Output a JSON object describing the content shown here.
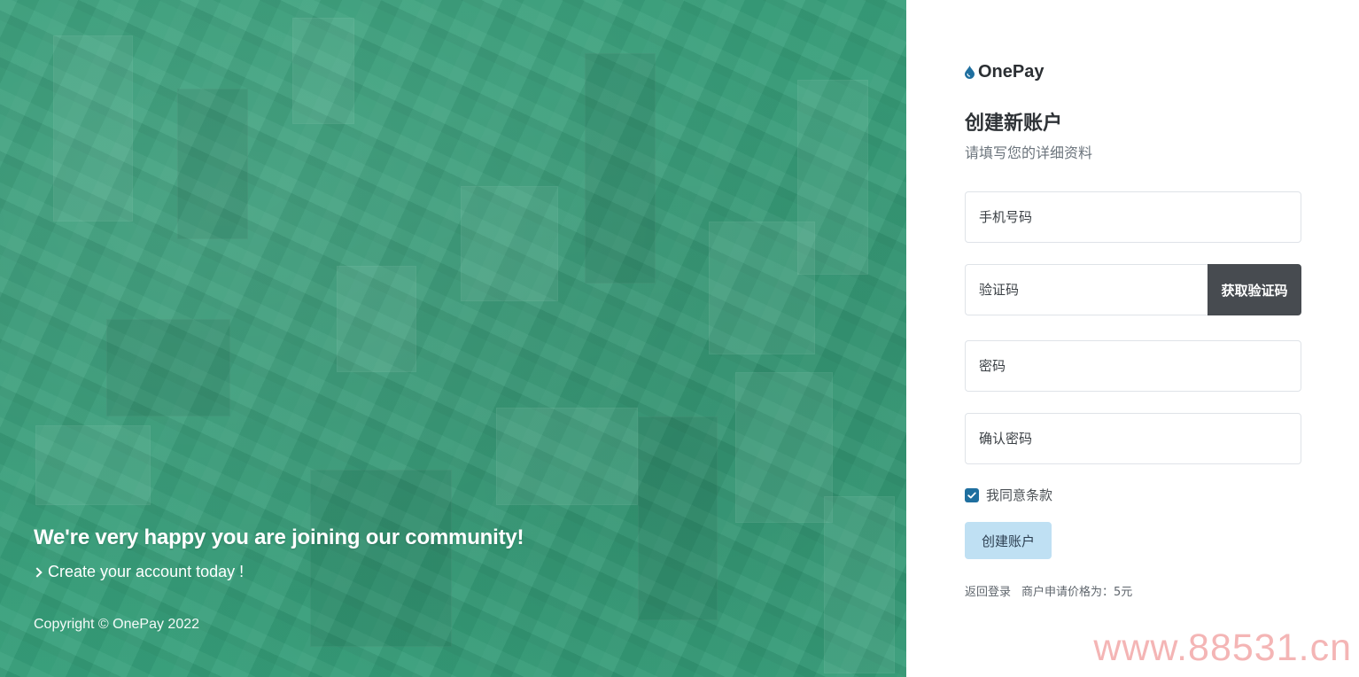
{
  "hero": {
    "title": "We're very happy you are joining our community!",
    "subtitle": "Create your account today !",
    "copyright": "Copyright © OnePay 2022",
    "bg_color": "#3a9a79"
  },
  "brand": {
    "name": "OnePay",
    "icon": "water-drop-icon",
    "icon_color": "#1f6f9f"
  },
  "form": {
    "title": "创建新账户",
    "subtitle": "请填写您的详细资料",
    "phone_placeholder": "手机号码",
    "code_placeholder": "验证码",
    "get_code_label": "获取验证码",
    "password_placeholder": "密码",
    "confirm_password_placeholder": "确认密码",
    "agree_label": "我同意条款",
    "agree_checked": true,
    "submit_label": "创建账户",
    "back_to_login": "返回登录",
    "price_note": "商户申请价格为：5元"
  },
  "watermark": "www.88531.cn",
  "colors": {
    "accent": "#1f6f9f",
    "code_button_bg": "#474b50",
    "submit_button_bg": "#bfe0f3"
  }
}
